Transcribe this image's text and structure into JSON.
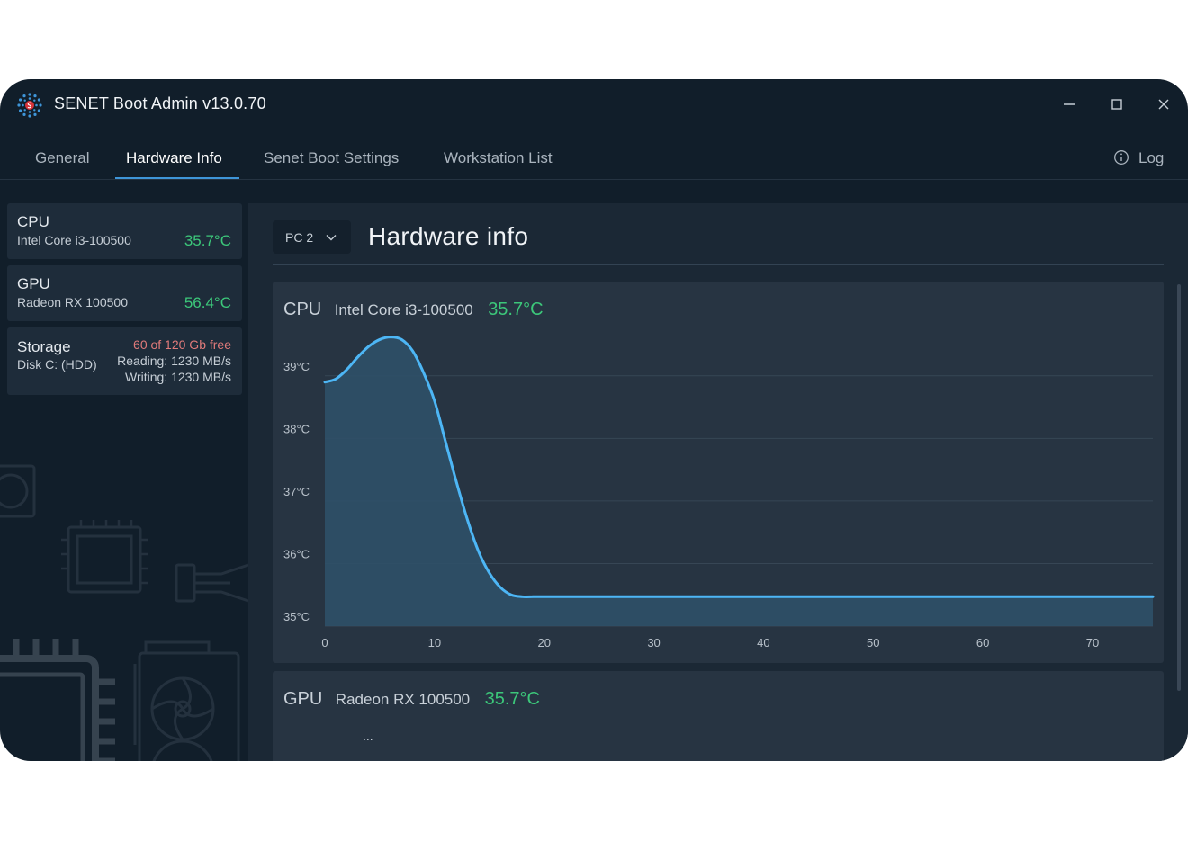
{
  "window": {
    "title": "SENET Boot Admin v13.0.70"
  },
  "tabs": [
    {
      "label": "General",
      "active": false
    },
    {
      "label": "Hardware Info",
      "active": true
    },
    {
      "label": "Senet Boot Settings",
      "active": false
    },
    {
      "label": "Workstation List",
      "active": false
    }
  ],
  "log": {
    "label": "Log"
  },
  "sidebar": {
    "cpu": {
      "title": "CPU",
      "model": "Intel Core i3-100500",
      "temp": "35.7°C"
    },
    "gpu": {
      "title": "GPU",
      "model": "Radeon RX 100500",
      "temp": "56.4°C"
    },
    "storage": {
      "title": "Storage",
      "disk": "Disk C: (HDD)",
      "free": "60 of 120 Gb free",
      "reading": "Reading: 1230 MB/s",
      "writing": "Writing: 1230 MB/s"
    }
  },
  "main": {
    "pc_select": "PC 2",
    "title": "Hardware info",
    "cpu_card": {
      "type": "CPU",
      "model": "Intel Core i3-100500",
      "temp": "35.7°C"
    },
    "gpu_card": {
      "type": "GPU",
      "model": "Radeon RX 100500",
      "temp": "35.7°C",
      "ellipsis": "..."
    }
  },
  "colors": {
    "accent": "#3e95d8",
    "line": "#4db6f5",
    "ok": "#3cc77a",
    "warn": "#e07a7a"
  },
  "chart_data": {
    "type": "area",
    "title": "",
    "xlabel": "",
    "ylabel": "",
    "x_ticks": [
      0,
      10,
      20,
      30,
      40,
      50,
      60,
      70
    ],
    "y_ticks": [
      "35°C",
      "36°C",
      "37°C",
      "38°C",
      "39°C"
    ],
    "xlim": [
      0,
      75.5
    ],
    "ylim": [
      35,
      39.5
    ],
    "grid": true,
    "series": [
      {
        "x": [
          0,
          1,
          2,
          3,
          4,
          5,
          6,
          7,
          8,
          9,
          10,
          11,
          12,
          13,
          14,
          15,
          16,
          17,
          18,
          19,
          20,
          30,
          40,
          50,
          60,
          70,
          75.5
        ],
        "y": [
          38.9,
          38.95,
          39.1,
          39.3,
          39.47,
          39.58,
          39.62,
          39.58,
          39.4,
          39.05,
          38.6,
          37.95,
          37.3,
          36.7,
          36.2,
          35.85,
          35.62,
          35.5,
          35.47,
          35.47,
          35.47,
          35.47,
          35.47,
          35.47,
          35.47,
          35.47,
          35.47
        ]
      }
    ]
  }
}
